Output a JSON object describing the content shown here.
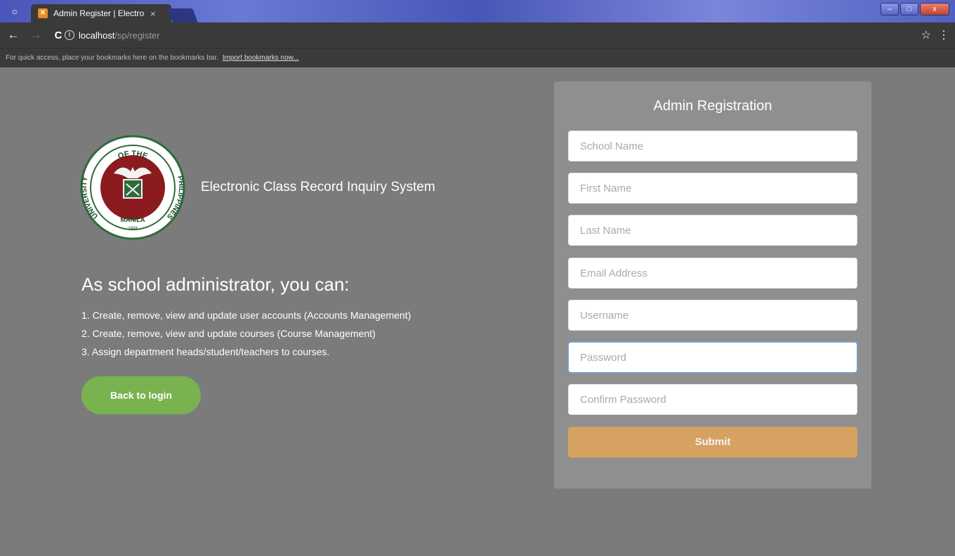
{
  "browser": {
    "tab_title": "Admin Register | Electron",
    "tab_close": "×",
    "url_host": "localhost",
    "url_path": "/sp/register",
    "bookmarks_text": "For quick access, place your bookmarks here on the bookmarks bar.",
    "bookmarks_link": "Import bookmarks now...",
    "back_icon": "←",
    "forward_icon": "→",
    "reload_icon": "C",
    "info_icon": "i",
    "star_icon": "☆",
    "menu_icon": "⋮",
    "win_minimize": "–",
    "win_maximize": "□",
    "win_close": "x"
  },
  "branding": {
    "logo_top_text": "OF THE",
    "logo_left_text": "UNIVERSITY",
    "logo_right_text": "PHILIPPINES",
    "logo_bottom_text": "MANILA",
    "logo_year": "1908",
    "system_name": "Electronic Class Record Inquiry System"
  },
  "info": {
    "heading": "As school administrator, you can:",
    "capabilities": [
      "1. Create, remove, view and update user accounts (Accounts Management)",
      "2. Create, remove, view and update courses (Course Management)",
      "3. Assign department heads/student/teachers to courses."
    ],
    "back_button": "Back to login"
  },
  "form": {
    "title": "Admin Registration",
    "fields": [
      {
        "placeholder": "School Name",
        "value": ""
      },
      {
        "placeholder": "First Name",
        "value": ""
      },
      {
        "placeholder": "Last Name",
        "value": ""
      },
      {
        "placeholder": "Email Address",
        "value": ""
      },
      {
        "placeholder": "Username",
        "value": ""
      },
      {
        "placeholder": "Password",
        "value": ""
      },
      {
        "placeholder": "Confirm Password",
        "value": ""
      }
    ],
    "submit": "Submit"
  },
  "colors": {
    "page_bg": "#7b7b7b",
    "panel_bg": "#8f8f8f",
    "back_button": "#79b350",
    "submit_button": "#d5a262",
    "logo_red": "#8b1b1f",
    "logo_green": "#2f6b3a"
  }
}
